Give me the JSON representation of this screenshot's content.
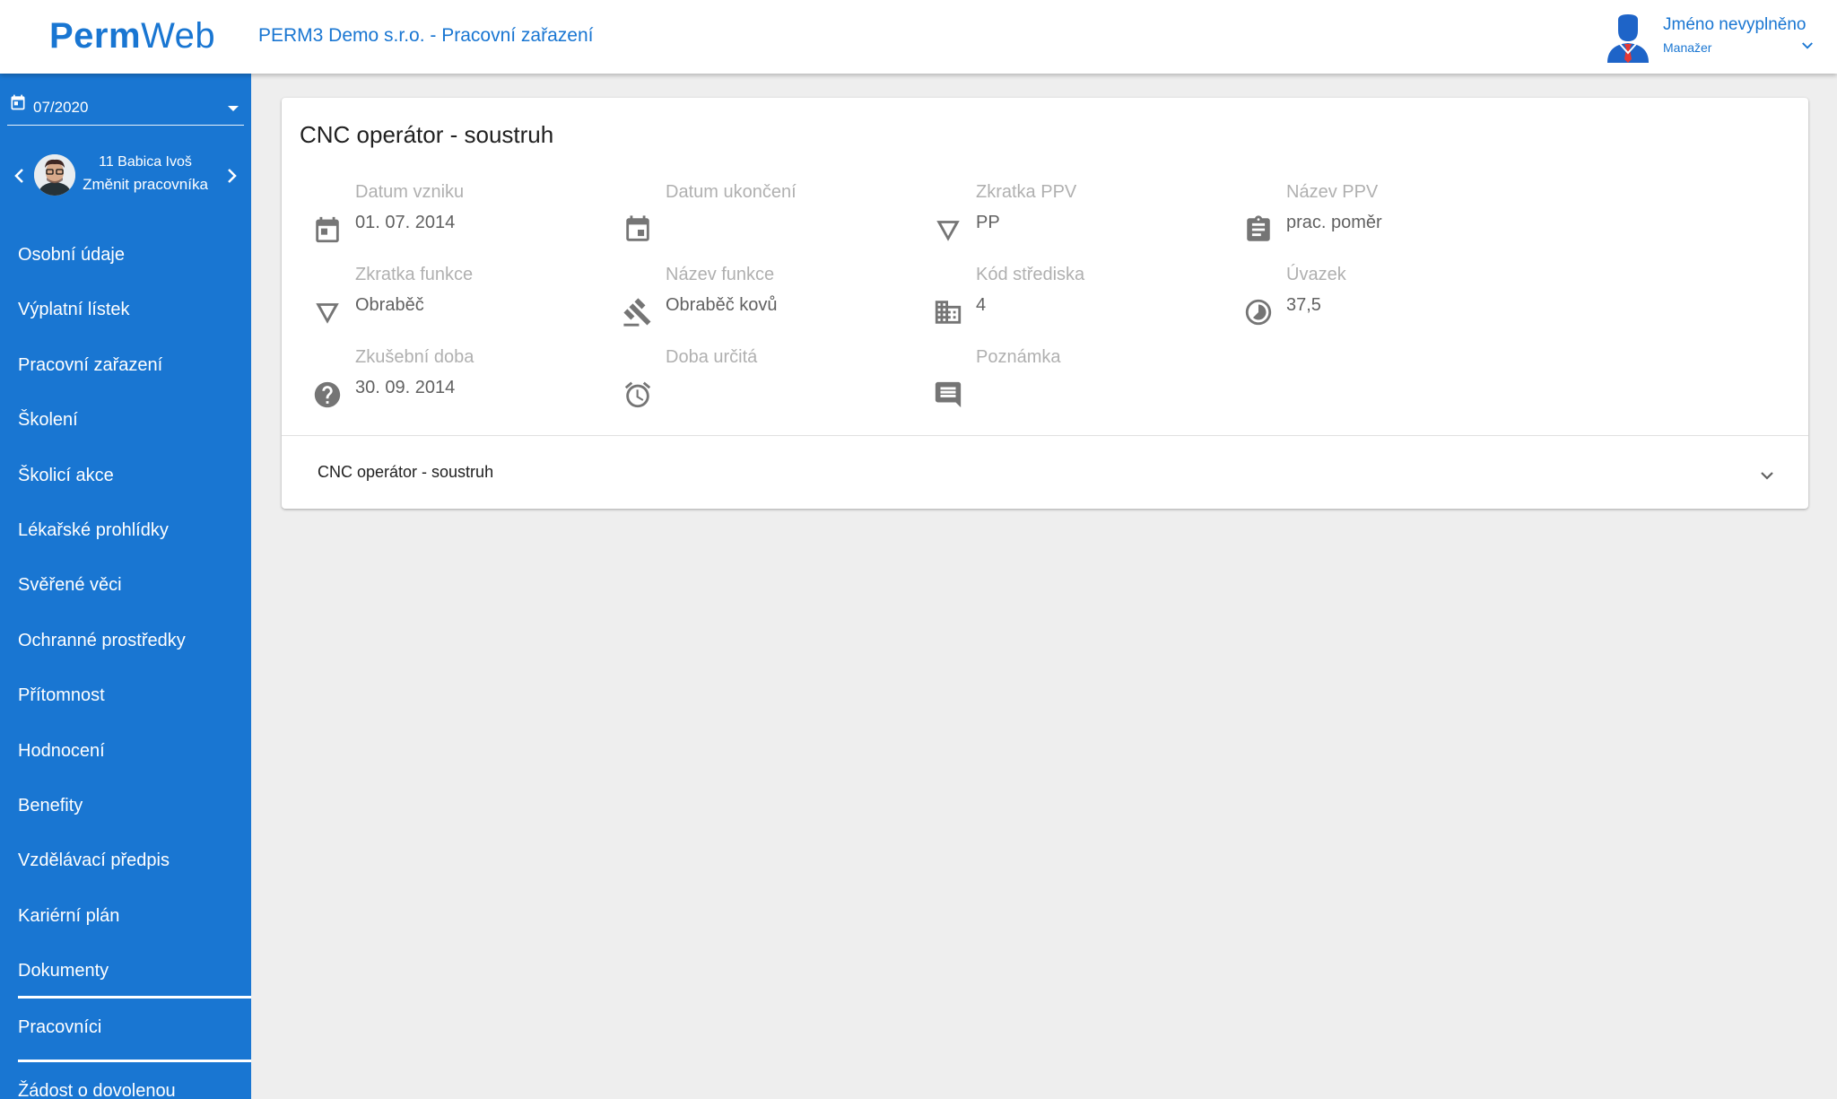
{
  "header": {
    "logo_part1": "Perm",
    "logo_part2": "Web",
    "title": "PERM3 Demo s.r.o. - Pracovní zařazení",
    "user_name": "Jméno nevyplněno",
    "user_role": "Manažer"
  },
  "sidebar": {
    "period": "07/2020",
    "employee_name": "11 Babica Ivoš",
    "change_employee": "Změnit pracovníka",
    "items": [
      {
        "label": "Osobní údaje"
      },
      {
        "label": "Výplatní lístek"
      },
      {
        "label": "Pracovní zařazení"
      },
      {
        "label": "Školení"
      },
      {
        "label": "Školicí akce"
      },
      {
        "label": "Lékařské prohlídky"
      },
      {
        "label": "Svěřené věci"
      },
      {
        "label": "Ochranné prostředky"
      },
      {
        "label": "Přítomnost"
      },
      {
        "label": "Hodnocení"
      },
      {
        "label": "Benefity"
      },
      {
        "label": "Vzdělávací předpis"
      },
      {
        "label": "Kariérní plán"
      },
      {
        "label": "Dokumenty"
      }
    ],
    "workers": "Pracovníci",
    "leave_request": "Žádost o dovolenou"
  },
  "card": {
    "title": "CNC operátor - soustruh",
    "fields": [
      {
        "label": "Datum vzniku",
        "value": "01. 07. 2014",
        "icon": "calendar-icon"
      },
      {
        "label": "Datum ukončení",
        "value": "",
        "icon": "calendar-event-icon"
      },
      {
        "label": "Zkratka PPV",
        "value": "PP",
        "icon": "triangle-down-icon"
      },
      {
        "label": "Název PPV",
        "value": "prac. poměr",
        "icon": "clipboard-icon"
      },
      {
        "label": "Zkratka funkce",
        "value": "Obraběč",
        "icon": "triangle-down-icon"
      },
      {
        "label": "Název funkce",
        "value": "Obraběč kovů",
        "icon": "gavel-icon"
      },
      {
        "label": "Kód střediska",
        "value": "4",
        "icon": "building-icon"
      },
      {
        "label": "Úvazek",
        "value": "37,5",
        "icon": "timelapse-icon"
      },
      {
        "label": "Zkušební doba",
        "value": "30. 09. 2014",
        "icon": "help-circle-icon"
      },
      {
        "label": "Doba určitá",
        "value": "",
        "icon": "alarm-icon"
      },
      {
        "label": "Poznámka",
        "value": "",
        "icon": "comment-icon"
      }
    ],
    "expansion_label": "CNC operátor - soustruh"
  },
  "colors": {
    "primary": "#1976d2",
    "background": "#eeeeee",
    "icon": "#757575",
    "label": "#b0b0b0"
  }
}
